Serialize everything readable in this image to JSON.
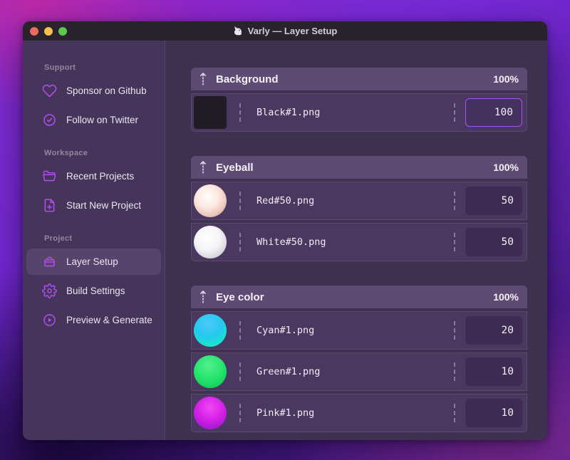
{
  "window": {
    "title": "Varly — Layer Setup",
    "app_icon": "unicorn-icon"
  },
  "titlebar": {
    "buttons": [
      {
        "name": "close-button",
        "color": "#ed6a5f"
      },
      {
        "name": "minimize-button",
        "color": "#f5bf4f"
      },
      {
        "name": "zoom-button",
        "color": "#61c554"
      }
    ]
  },
  "sidebar": {
    "sections": [
      {
        "label": "Support",
        "items": [
          {
            "label": "Sponsor on Github",
            "icon": "heart-icon"
          },
          {
            "label": "Follow on Twitter",
            "icon": "verified-badge-icon"
          }
        ]
      },
      {
        "label": "Workspace",
        "items": [
          {
            "label": "Recent Projects",
            "icon": "folder-icon"
          },
          {
            "label": "Start New Project",
            "icon": "file-plus-icon"
          }
        ]
      },
      {
        "label": "Project",
        "items": [
          {
            "label": "Layer Setup",
            "icon": "layers-box-icon",
            "selected": true
          },
          {
            "label": "Build Settings",
            "icon": "gear-icon"
          },
          {
            "label": "Preview & Generate",
            "icon": "play-circle-icon"
          }
        ]
      }
    ]
  },
  "layers": {
    "groups": [
      {
        "name": "Background",
        "weight": "100%",
        "items": [
          {
            "file": "Black#1.png",
            "value": "100",
            "thumb": "black-swatch",
            "focused": true
          }
        ]
      },
      {
        "name": "Eyeball",
        "weight": "100%",
        "items": [
          {
            "file": "Red#50.png",
            "value": "50",
            "thumb": "red-sphere"
          },
          {
            "file": "White#50.png",
            "value": "50",
            "thumb": "white-sphere"
          }
        ]
      },
      {
        "name": "Eye color",
        "weight": "100%",
        "items": [
          {
            "file": "Cyan#1.png",
            "value": "20",
            "thumb": "cyan-sphere"
          },
          {
            "file": "Green#1.png",
            "value": "10",
            "thumb": "green-sphere"
          },
          {
            "file": "Pink#1.png",
            "value": "10",
            "thumb": "pink-sphere"
          }
        ]
      }
    ]
  },
  "colors": {
    "accent": "#b44df5",
    "focus_border": "#b44df5",
    "sidebar_bg": "#46355a",
    "main_bg": "#3f3150",
    "group_header_bg": "#5e4b74",
    "row_bg": "#4a3860",
    "titlebar_bg": "#28232c",
    "selected_item_bg": "#57446c"
  }
}
